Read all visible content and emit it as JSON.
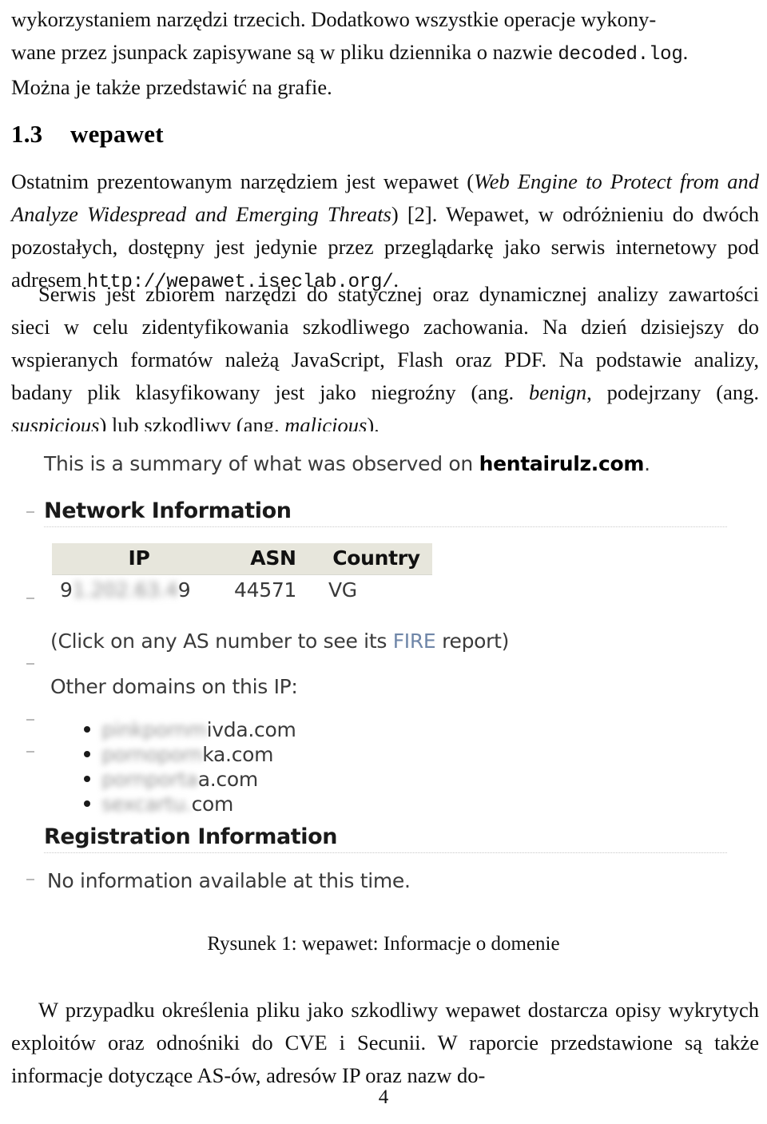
{
  "document": {
    "page_number": "4",
    "language": "pl"
  },
  "top_paragraph": {
    "line1_pre": "wykorzystaniem narzędzi trzecich. Dodatkowo wszystkie operacje wykony-",
    "line2_pre": "wane przez jsunpack zapisywane są w pliku dziennika o nazwie ",
    "line2_mono": "decoded.log",
    "line2_post": ".",
    "line3": "Można je także przedstawić na grafie."
  },
  "section": {
    "number": "1.3",
    "title": "wepawet"
  },
  "paragraph1": {
    "seg1": "Ostatnim prezentowanym narzędziem jest wepawet (",
    "italic1": "Web Engine to Protect from and Analyze Widespread and Emerging Threats",
    "seg2": ") [2]. Wepawet, w odróżnieniu do dwóch pozostałych, dostępny jest jedynie przez przeglądarkę jako serwis internetowy pod adresem ",
    "mono1": "http://wepawet.iseclab.org/",
    "seg3": "."
  },
  "paragraph2": {
    "seg1": "Serwis jest zbiorem narzędzi do statycznej oraz dynamicznej analizy zawartości sieci w celu zidentyfikowania szkodliwego zachowania. Na dzień dzisiejszy do wspieranych formatów należą JavaScript, Flash oraz PDF. Na podstawie analizy, badany plik klasyfikowany jest jako niegroźny (ang. ",
    "italic1": "benign",
    "seg2": ", podejrzany (ang. ",
    "italic2": "suspicious",
    "seg3": ") lub szkodliwy (ang. ",
    "italic3": "malicious",
    "seg4": ")."
  },
  "figure": {
    "caption": "Rysunek 1: wepawet: Informacje o domenie",
    "screenshot": {
      "summary_prefix": "This is a summary of what was observed on ",
      "summary_domain": "hentairulz.com",
      "summary_suffix": ".",
      "network_heading": "Network Information",
      "table": {
        "headers": [
          "IP",
          "ASN",
          "Country"
        ],
        "rows": [
          {
            "ip_visible_start": "9",
            "ip_redacted": "1.202.63.4",
            "ip_visible_end": "9",
            "asn": "44571",
            "country": "VG"
          }
        ]
      },
      "table_note_pre": "(Click on any AS number to see its ",
      "table_note_link": "FIRE",
      "table_note_post": " report)",
      "other_domains_label": "Other domains on this IP:",
      "other_domains": [
        {
          "redacted": "pinkpornm",
          "visible": "ivda.com"
        },
        {
          "redacted": "pornoporn",
          "visible": "ka.com"
        },
        {
          "redacted": "pornporta",
          "visible": "a.com"
        },
        {
          "redacted": "sexcartu.",
          "visible": "com"
        }
      ],
      "registration_heading": "Registration Information",
      "registration_text": "No information available at this time."
    }
  },
  "paragraph3": {
    "text": "W przypadku określenia pliku jako szkodliwy wepawet dostarcza opisy wykrytych exploitów oraz odnośniki do CVE i Secunii. W raporcie przedstawione są także informacje dotyczące AS-ów, adresów IP oraz nazw do-"
  },
  "colors": {
    "link": "#6f86a8",
    "table_header_bg": "#e7e6dc",
    "text": "#111111"
  }
}
